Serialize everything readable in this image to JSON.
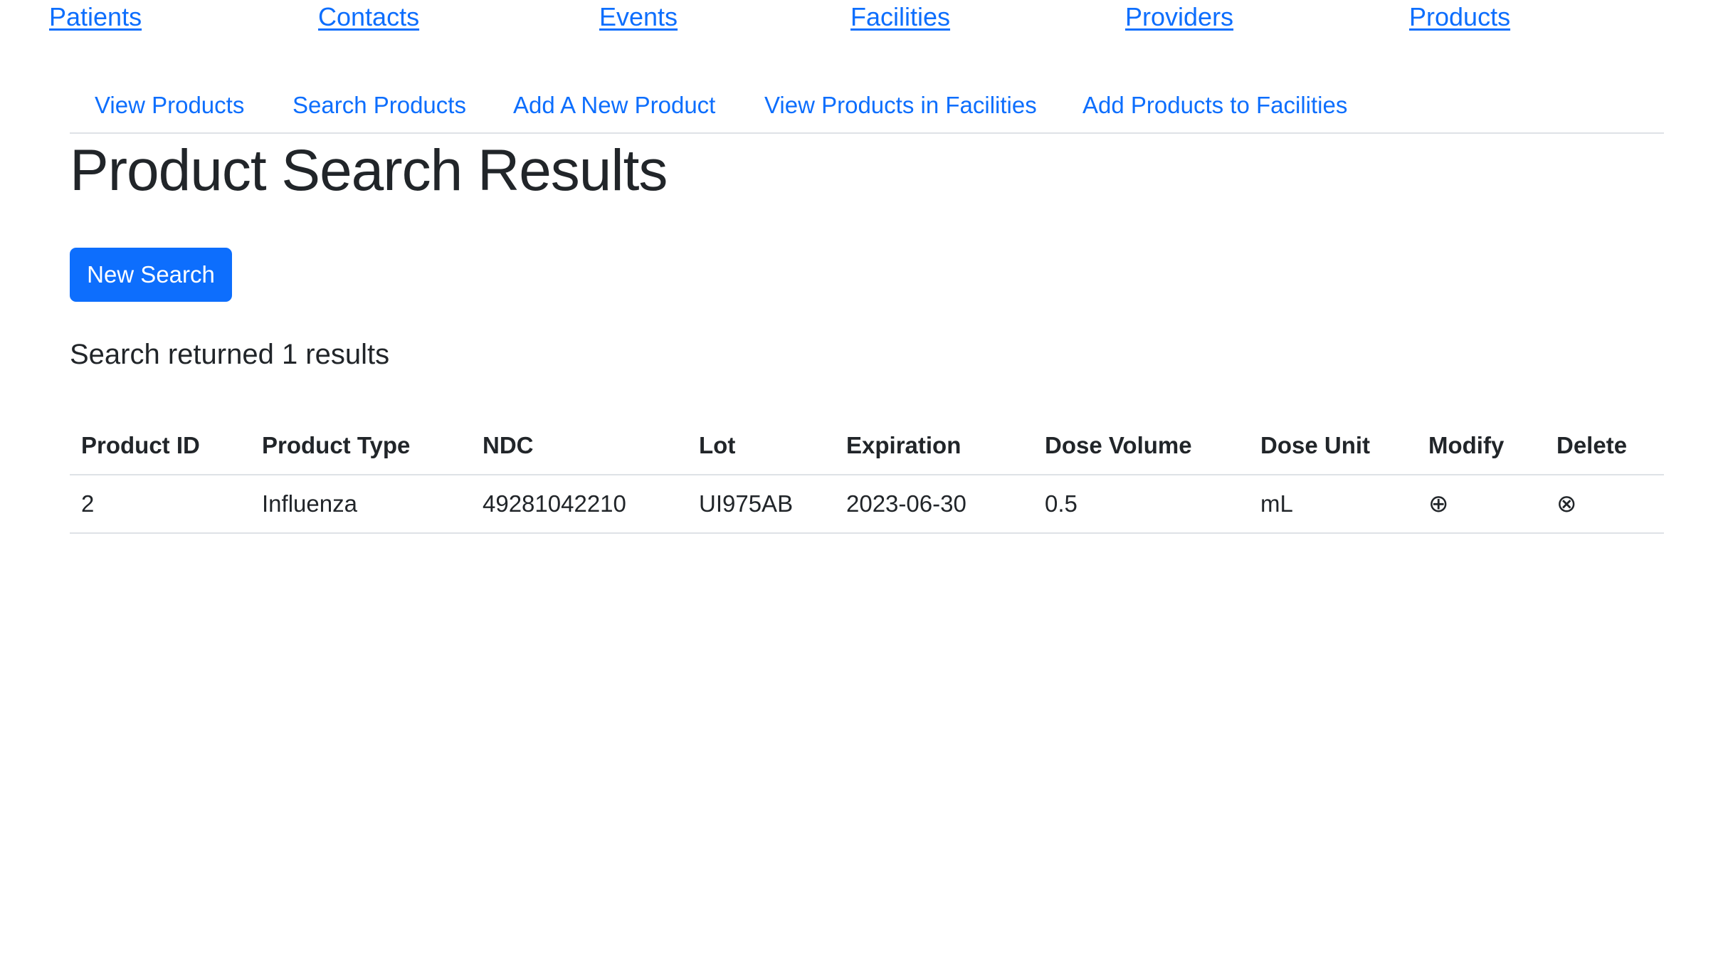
{
  "top_nav": {
    "patients": "Patients",
    "contacts": "Contacts",
    "events": "Events",
    "facilities": "Facilities",
    "providers": "Providers",
    "products": "Products"
  },
  "sub_nav": {
    "view_products": "View Products",
    "search_products": "Search Products",
    "add_product": "Add A New Product",
    "view_in_facilities": "View Products in Facilities",
    "add_to_facilities": "Add Products to Facilities"
  },
  "page": {
    "title": "Product Search Results",
    "new_search_label": "New Search",
    "results_text": "Search returned 1 results"
  },
  "table": {
    "headers": [
      "Product ID",
      "Product Type",
      "NDC",
      "Lot",
      "Expiration",
      "Dose Volume",
      "Dose Unit",
      "Modify",
      "Delete"
    ],
    "rows": [
      {
        "product_id": "2",
        "product_type": "Influenza",
        "ndc": "49281042210",
        "lot": "UI975AB",
        "expiration": "2023-06-30",
        "dose_volume": "0.5",
        "dose_unit": "mL",
        "modify_icon": "⊕",
        "delete_icon": "⊗"
      }
    ]
  },
  "icons": {
    "modify": "circled-plus-icon",
    "delete": "circled-x-icon"
  },
  "colors": {
    "link": "#0d6efd",
    "button_bg": "#0d6efd",
    "text": "#212529",
    "divider": "#dee2e6"
  }
}
